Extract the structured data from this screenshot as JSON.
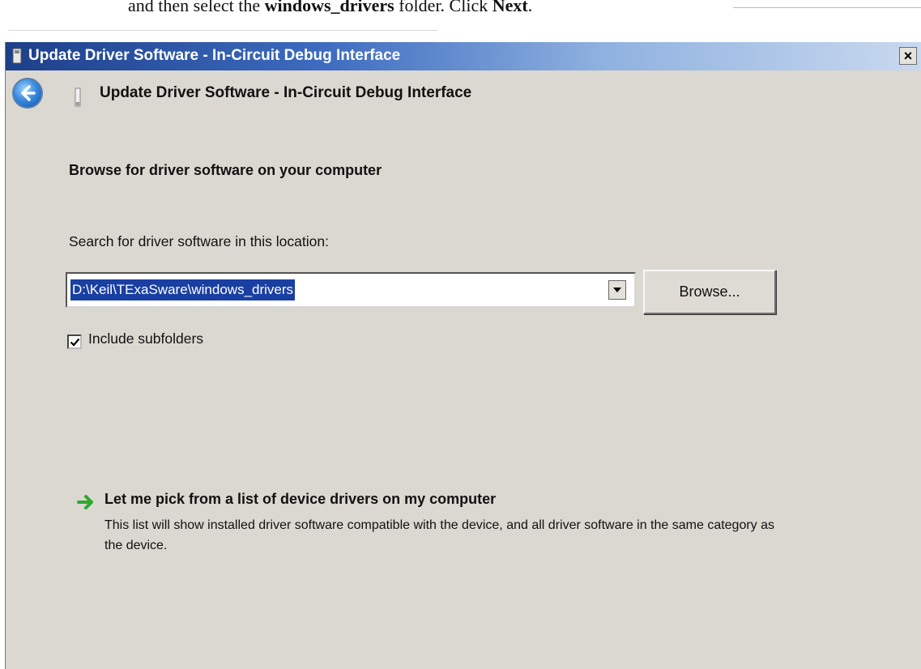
{
  "caption": {
    "prefix": "and then select  the ",
    "folder_name": "windows_drivers",
    "middle": " folder. Click ",
    "next_word": "Next",
    "suffix": "."
  },
  "window": {
    "title": "Update Driver Software - In-Circuit Debug Interface",
    "close_glyph": "×"
  },
  "header": {
    "title": "Update Driver Software - In-Circuit Debug Interface"
  },
  "content": {
    "heading": "Browse for driver software on your computer",
    "search_label": "Search for driver software in this location:",
    "path_value": "D:\\Keil\\TExaSware\\windows_drivers",
    "browse_label": "Browse...",
    "include_subfolders_label": "Include subfolders",
    "include_subfolders_checked": true
  },
  "pick_option": {
    "title": "Let me pick from a list of device drivers on my computer",
    "description": "This list will show installed driver software compatible with the device, and all driver software in the same category as the device."
  },
  "icons": {
    "back": "back-arrow-icon",
    "device": "usb-device-icon",
    "window": "window-app-icon",
    "dropdown": "chevron-down-icon",
    "check": "checkmark-icon",
    "pick": "green-arrow-icon"
  },
  "colors": {
    "titlebar_start": "#1d3f8a",
    "titlebar_end": "#c9d9ef",
    "dialog_bg": "#dbd8d1",
    "selection_bg": "#1a3fa3",
    "pick_arrow": "#2ea82e"
  }
}
